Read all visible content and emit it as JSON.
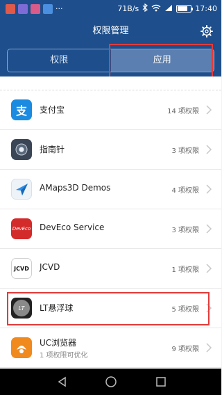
{
  "status_bar": {
    "speed": "71B/s",
    "time": "17:40"
  },
  "header": {
    "title": "权限管理"
  },
  "tabs": [
    {
      "label": "权限",
      "active": false
    },
    {
      "label": "应用",
      "active": true
    }
  ],
  "apps": [
    {
      "name": "支付宝",
      "sub": "",
      "perm": "14 项权限",
      "icon": "alipay-icon"
    },
    {
      "name": "指南针",
      "sub": "",
      "perm": "3 项权限",
      "icon": "compass-icon"
    },
    {
      "name": "AMaps3D Demos",
      "sub": "",
      "perm": "4 项权限",
      "icon": "amaps-icon"
    },
    {
      "name": "DevEco Service",
      "sub": "",
      "perm": "3 项权限",
      "icon": "deveco-icon"
    },
    {
      "name": "JCVD",
      "sub": "",
      "perm": "1 项权限",
      "icon": "jcvd-icon"
    },
    {
      "name": "LT悬浮球",
      "sub": "",
      "perm": "5 项权限",
      "icon": "lt-floatball-icon"
    },
    {
      "name": "UC浏览器",
      "sub": "1 项权限可优化",
      "perm": "9 项权限",
      "icon": "uc-browser-icon"
    }
  ],
  "icon_labels": {
    "alipay": "支",
    "deveco": "DevEco",
    "jcvd": "JCVD",
    "lt": "LT"
  },
  "colors": {
    "header": "#1e4f8c",
    "tab_active": "#5b7fb0",
    "highlight": "#e23b3b"
  }
}
